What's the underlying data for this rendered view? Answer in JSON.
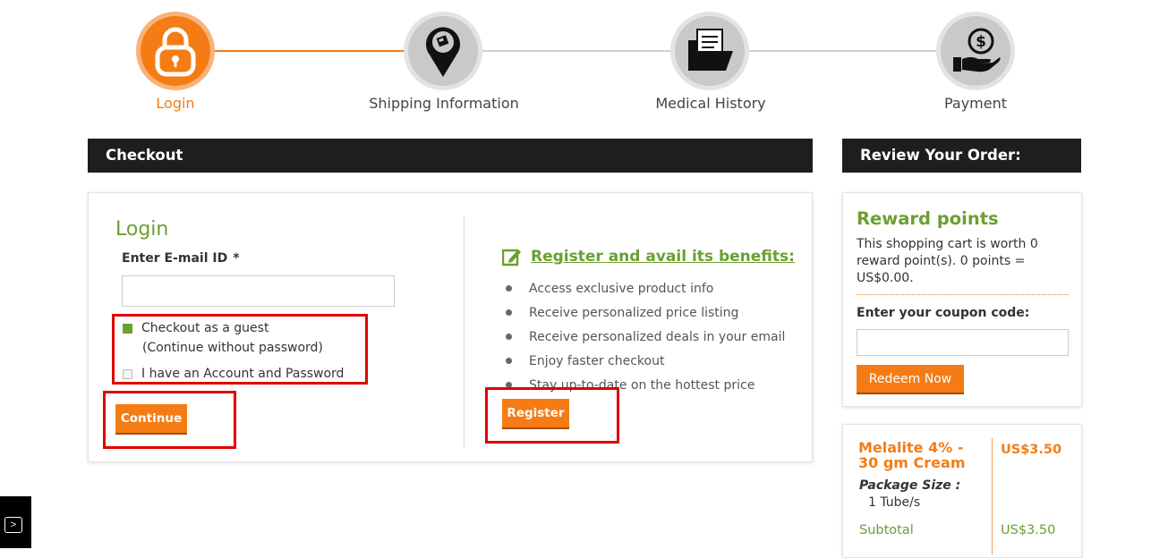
{
  "steps": [
    {
      "label": "Login",
      "icon": "lock-icon",
      "active": true
    },
    {
      "label": "Shipping Information",
      "icon": "map-pin-icon",
      "active": false
    },
    {
      "label": "Medical History",
      "icon": "folder-documents-icon",
      "active": false
    },
    {
      "label": "Payment",
      "icon": "hand-coin-icon",
      "active": false
    }
  ],
  "colors": {
    "accent_orange": "#f57c14",
    "accent_green": "#6aa031",
    "header_bar": "#1e1e1e",
    "highlight_red": "#e00000"
  },
  "checkout": {
    "bar_title": "Checkout",
    "login_title": "Login",
    "email_label": "Enter E-mail ID",
    "required_mark": "*",
    "email_value": "",
    "guest_option": "Checkout as a guest",
    "guest_sub": "(Continue without password)",
    "account_option": "I have an Account and Password",
    "continue_label": "Continue",
    "register_title": "Register and avail its benefits:",
    "benefits": [
      "Access exclusive product info",
      "Receive personalized price listing",
      "Receive personalized deals in your email",
      "Enjoy faster checkout",
      "Stay up-to-date on the hottest price"
    ],
    "register_label": "Register"
  },
  "review": {
    "bar_title": "Review Your Order:",
    "reward_title": "Reward points",
    "reward_text": "This shopping cart is worth 0 reward point(s). 0 points = US$0.00.",
    "coupon_label": "Enter your coupon code:",
    "coupon_value": "",
    "redeem_label": "Redeem Now",
    "product": {
      "name": "Melalite 4% - 30 gm Cream",
      "price": "US$3.50",
      "package_label": "Package Size :",
      "package_value": "1 Tube/s",
      "subtotal_label": "Subtotal",
      "subtotal_value": "US$3.50"
    }
  },
  "side_toggle": ">"
}
